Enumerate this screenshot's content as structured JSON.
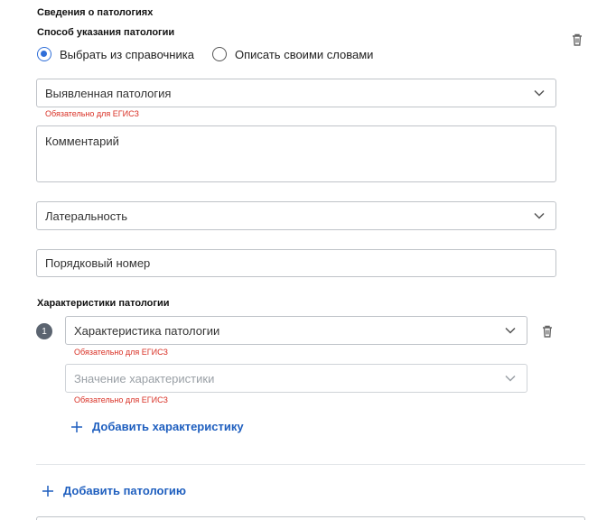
{
  "section": {
    "title": "Сведения о патологиях",
    "method_label": "Способ указания патологии",
    "options": [
      "Выбрать из справочника",
      "Описать своими словами"
    ],
    "selected_option": 0
  },
  "fields": {
    "pathology": {
      "placeholder": "Выявленная патология",
      "error": "Обязательно для ЕГИСЗ"
    },
    "comment": {
      "placeholder": "Комментарий"
    },
    "laterality": {
      "placeholder": "Латеральность"
    },
    "order_number": {
      "placeholder": "Порядковый номер"
    }
  },
  "characteristics": {
    "title": "Характеристики патологии",
    "items": [
      {
        "index": "1",
        "characteristic": {
          "placeholder": "Характеристика патологии",
          "error": "Обязательно для ЕГИСЗ"
        },
        "value": {
          "placeholder": "Значение характеристики",
          "error": "Обязательно для ЕГИСЗ"
        }
      }
    ],
    "add_label": "Добавить характеристику"
  },
  "add_pathology_label": "Добавить патологию",
  "colors": {
    "accent": "#2f6ed8",
    "link": "#1f5fbf",
    "error": "#d93025"
  },
  "icons": {
    "delete": "trash-icon",
    "dropdown": "chevron-down-icon",
    "add": "plus-icon"
  }
}
